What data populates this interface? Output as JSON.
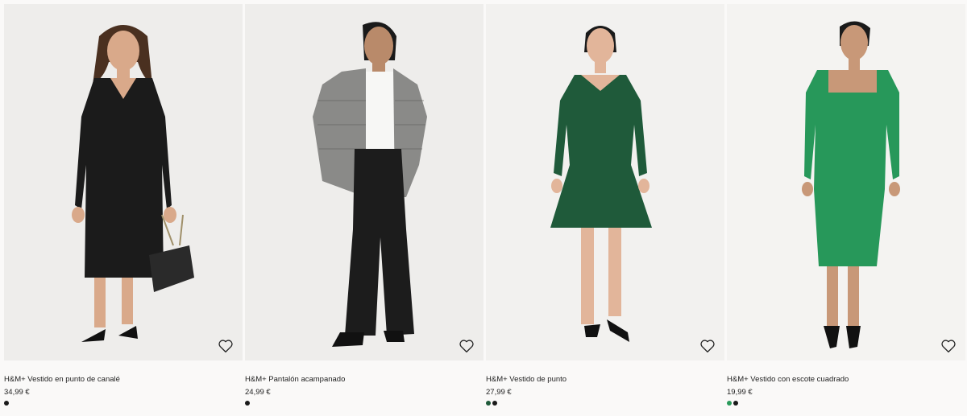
{
  "products": [
    {
      "name": "H&M+ Vestido en punto de canalé",
      "price": "34,99 €",
      "swatches": [
        "#1a1a1a"
      ],
      "image": "model-black-knit-dress"
    },
    {
      "name": "H&M+ Pantalón acampanado",
      "price": "24,99 €",
      "swatches": [
        "#1a1a1a"
      ],
      "image": "model-flared-trousers-check-shirt"
    },
    {
      "name": "H&M+ Vestido de punto",
      "price": "27,99 €",
      "swatches": [
        "#1f5a3a",
        "#1a1a1a"
      ],
      "image": "model-dark-green-skater-dress"
    },
    {
      "name": "H&M+ Vestido con escote cuadrado",
      "price": "19,99 €",
      "swatches": [
        "#2a9a5a",
        "#1a1a1a"
      ],
      "image": "model-green-square-neck-dress"
    }
  ],
  "icons": {
    "favorite": "heart-icon"
  }
}
